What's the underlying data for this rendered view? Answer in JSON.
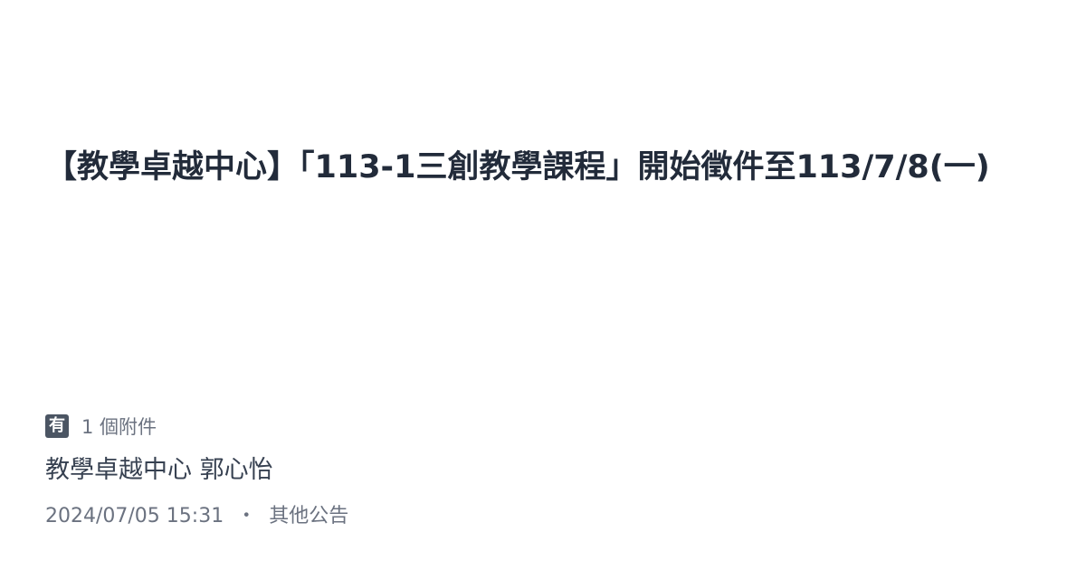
{
  "announcement": {
    "title": "【教學卓越中心】「113-1三創教學課程」開始徵件至113/7/8(一)",
    "attachment_badge": "有",
    "attachment_count": "1 個附件",
    "author": "教學卓越中心 郭心怡",
    "timestamp": "2024/07/05 15:31",
    "separator": "・",
    "category": "其他公告"
  },
  "colors": {
    "title": "#222b3a",
    "badge_bg": "#4b5563",
    "muted_text": "#6b7280"
  },
  "icons": {
    "attachment": "attachment-badge-icon"
  }
}
